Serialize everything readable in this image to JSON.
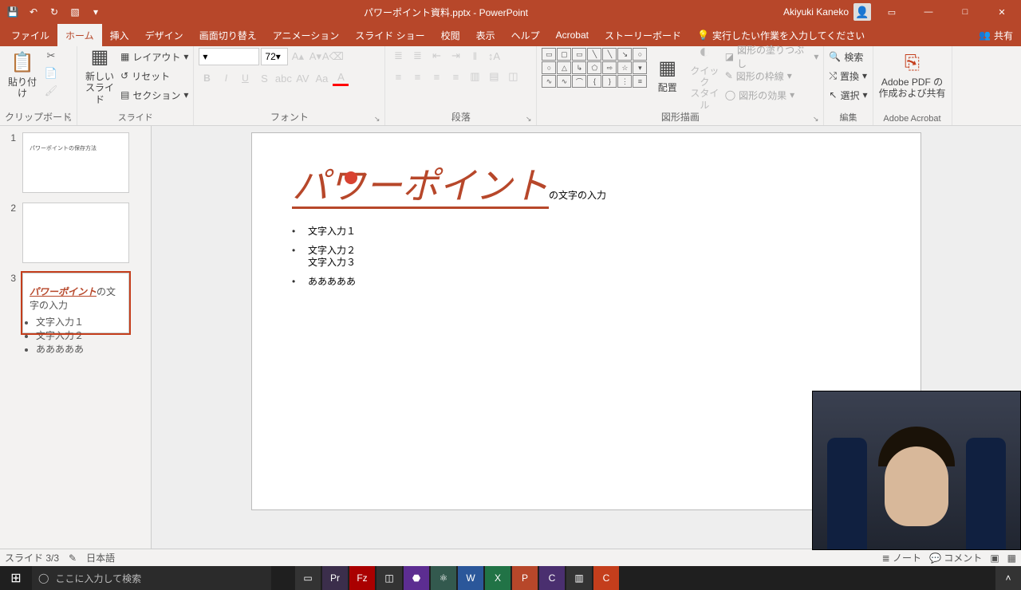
{
  "titlebar": {
    "title": "パワーポイント資料.pptx - PowerPoint",
    "user": "Akiyuki Kaneko"
  },
  "tabs": {
    "file": "ファイル",
    "home": "ホーム",
    "insert": "挿入",
    "design": "デザイン",
    "transition": "画面切り替え",
    "animation": "アニメーション",
    "slideshow": "スライド ショー",
    "review": "校閲",
    "view": "表示",
    "help": "ヘルプ",
    "acrobat": "Acrobat",
    "storyboard": "ストーリーボード",
    "tellme": "実行したい作業を入力してください",
    "share": "共有"
  },
  "ribbon": {
    "clipboard": {
      "label": "クリップボード",
      "paste": "貼り付け"
    },
    "slides": {
      "label": "スライド",
      "new": "新しい\nスライド",
      "layout": "レイアウト",
      "reset": "リセット",
      "section": "セクション"
    },
    "font": {
      "label": "フォント",
      "size": "72"
    },
    "paragraph": {
      "label": "段落"
    },
    "drawing": {
      "label": "図形描画",
      "arrange": "配置",
      "quick": "クイック\nスタイル",
      "fill": "図形の塗りつぶし",
      "outline": "図形の枠線",
      "effects": "図形の効果"
    },
    "editing": {
      "label": "編集",
      "find": "検索",
      "replace": "置換",
      "select": "選択"
    },
    "acrobat": {
      "label": "Adobe Acrobat",
      "create": "Adobe PDF の\n作成および共有"
    }
  },
  "thumbnails": [
    {
      "title": "パワーポイントの保存方法"
    },
    {
      "title": ""
    },
    {
      "title_em": "パワーポイント",
      "title_rest": "の文字の入力",
      "items": [
        "文字入力１",
        "文字入力２",
        "あああああ"
      ]
    }
  ],
  "slide": {
    "title_em": "パワーポイント",
    "title_rest": "の文字の入力",
    "bullets": [
      {
        "lines": [
          "文字入力１"
        ]
      },
      {
        "lines": [
          "文字入力２",
          "文字入力３"
        ]
      },
      {
        "lines": [
          "あああああ"
        ]
      }
    ]
  },
  "status": {
    "slide": "スライド 3/3",
    "lang": "日本語",
    "notes": "ノート",
    "comments": "コメント"
  },
  "taskbar": {
    "search_placeholder": "ここに入力して検索"
  }
}
